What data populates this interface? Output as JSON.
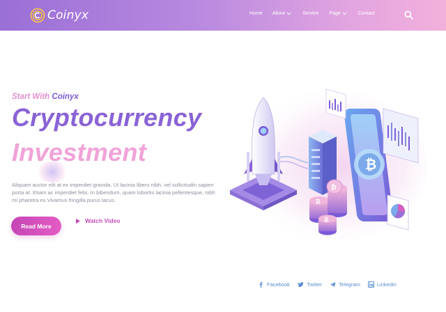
{
  "brand": {
    "name": "Coinyx"
  },
  "nav": {
    "items": [
      {
        "label": "Home",
        "has_dropdown": false
      },
      {
        "label": "About",
        "has_dropdown": true
      },
      {
        "label": "Service",
        "has_dropdown": false
      },
      {
        "label": "Page",
        "has_dropdown": true
      },
      {
        "label": "Contact",
        "has_dropdown": false
      }
    ],
    "search_icon": "search-icon"
  },
  "hero": {
    "subtitle_prefix": "Start With",
    "subtitle_brand": "Coinyx",
    "title_line1": "Cryptocurrency",
    "title_line2": "Investment",
    "description": "Aliquam auctor elit at ex imperdiet gravida. Ut lacinia libero nibh, vel sollicitudin sapien porta at. Etiam ac imperdiet felis. In bibendum, quam lobortis lacinia pellentesque, nibh mi pharetra ex.Vivamus fringilla purus lacus.",
    "read_more_label": "Read More",
    "watch_video_label": "Watch Video"
  },
  "social": [
    {
      "label": "Facebook",
      "icon": "facebook-icon"
    },
    {
      "label": "Twitter",
      "icon": "twitter-icon"
    },
    {
      "label": "Telegram",
      "icon": "telegram-icon"
    },
    {
      "label": "Linkedin",
      "icon": "linkedin-icon"
    }
  ],
  "colors": {
    "header_gradient_start": "#9a6fd6",
    "header_gradient_end": "#f2b0dc",
    "title_primary": "#8a63d6",
    "title_secondary": "#f0a3d8",
    "button_pink": "#d64fbf",
    "social_blue": "#5a8ecf"
  }
}
